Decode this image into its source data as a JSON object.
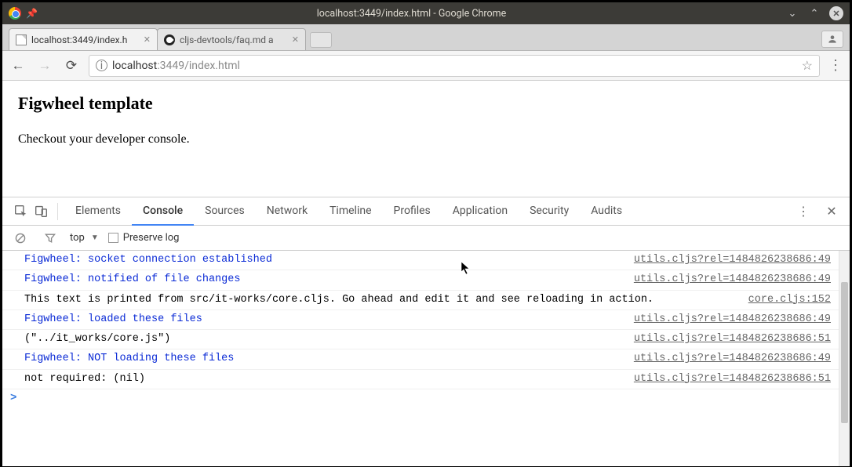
{
  "window": {
    "title": "localhost:3449/index.html - Google Chrome"
  },
  "tabs": [
    {
      "title": "localhost:3449/index.h",
      "active": true
    },
    {
      "title": "cljs-devtools/faq.md a",
      "active": false
    }
  ],
  "addressbar": {
    "host": "localhost",
    "port_path": ":3449/index.html"
  },
  "page": {
    "heading": "Figwheel template",
    "body": "Checkout your developer console."
  },
  "devtools": {
    "tabs": [
      "Elements",
      "Console",
      "Sources",
      "Network",
      "Timeline",
      "Profiles",
      "Application",
      "Security",
      "Audits"
    ],
    "active_tab": "Console",
    "console_toolbar": {
      "context": "top",
      "preserve_label": "Preserve log",
      "preserve_checked": false
    },
    "logs": [
      {
        "msg": "Figwheel: socket connection established",
        "src": "utils.cljs?rel=1484826238686:49",
        "blue": true
      },
      {
        "msg": "Figwheel: notified of file changes",
        "src": "utils.cljs?rel=1484826238686:49",
        "blue": true
      },
      {
        "msg": "This text is printed from src/it-works/core.cljs. Go ahead and edit it and see reloading in action.",
        "src": "core.cljs:152",
        "blue": false
      },
      {
        "msg": "Figwheel: loaded these files",
        "src": "utils.cljs?rel=1484826238686:49",
        "blue": true
      },
      {
        "msg": "(\"../it_works/core.js\")",
        "src": "utils.cljs?rel=1484826238686:51",
        "blue": false
      },
      {
        "msg": "Figwheel: NOT loading these files",
        "src": "utils.cljs?rel=1484826238686:49",
        "blue": true
      },
      {
        "msg": "not required: (nil)",
        "src": "utils.cljs?rel=1484826238686:51",
        "blue": false
      }
    ]
  }
}
